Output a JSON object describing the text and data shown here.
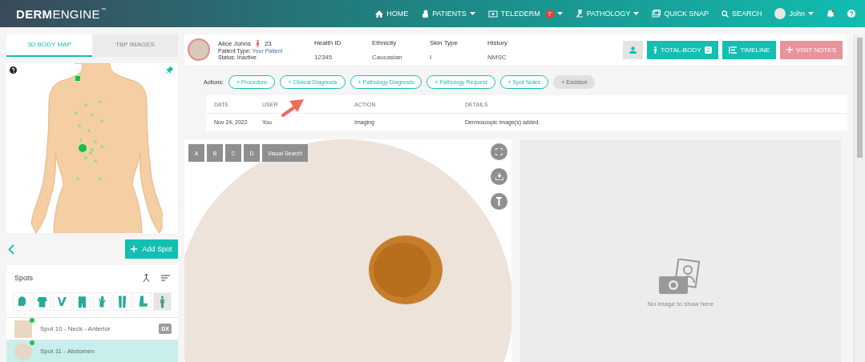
{
  "nav": {
    "logo_bold": "DERM",
    "logo_light": "ENGINE",
    "trademark": "™",
    "items": [
      {
        "label": "HOME",
        "dropdown": false
      },
      {
        "label": "PATIENTS",
        "dropdown": true
      },
      {
        "label": "TELEDERM",
        "badge": "7",
        "dropdown": true
      },
      {
        "label": "PATHOLOGY",
        "dropdown": true
      },
      {
        "label": "QUICK SNAP",
        "dropdown": false
      },
      {
        "label": "SEARCH",
        "dropdown": false
      }
    ],
    "user": {
      "name": "John",
      "dropdown": true
    }
  },
  "left": {
    "tabs": [
      {
        "label": "3D BODY MAP",
        "selected": true
      },
      {
        "label": "TBP IMAGES",
        "selected": false
      }
    ],
    "add_spot": "Add Spot",
    "spots_title": "Spots",
    "filters": [
      {
        "selected": false
      },
      {
        "selected": false
      },
      {
        "selected": false
      },
      {
        "selected": false
      },
      {
        "selected": false
      },
      {
        "selected": false
      },
      {
        "selected": false
      },
      {
        "selected": true
      }
    ],
    "spots": [
      {
        "name": "Spot 10 - Neck - Anterior",
        "badge": "DX",
        "selected": false
      },
      {
        "name": "Spot 11 - Abdomen",
        "selected": true
      }
    ]
  },
  "patient": {
    "name": "Alice Johns",
    "age": "23",
    "type_label": "Patient Type:",
    "type": "Your Patient",
    "status_label": "Status:",
    "status": "Inactive",
    "fields": [
      {
        "label": "Health ID",
        "value": "12345"
      },
      {
        "label": "Ethnicity",
        "value": "Caucasian"
      },
      {
        "label": "Skin Type",
        "value": "I"
      },
      {
        "label": "History",
        "value": "NMSC"
      }
    ],
    "total_body": {
      "label": "TOTAL-BODY",
      "count": "2"
    },
    "timeline": "TIMELINE",
    "visit_notes": "VISIT NOTES"
  },
  "actions": {
    "label": "Actions:",
    "items": [
      {
        "label": "+ Procedure",
        "disabled": false
      },
      {
        "label": "+ Clinical Diagnosis",
        "disabled": false
      },
      {
        "label": "+ Pathology Diagnosis",
        "disabled": false
      },
      {
        "label": "+ Pathology Request",
        "disabled": false
      },
      {
        "label": "+ Spot Notes",
        "disabled": false
      },
      {
        "label": "+ Excision",
        "disabled": true
      }
    ]
  },
  "table": {
    "columns": [
      "DATE",
      "USER",
      "ACTION",
      "DETAILS"
    ],
    "rows": [
      [
        "Nov 24, 2022",
        "You",
        "Imaging",
        "Dermoscopic image(s) added."
      ]
    ]
  },
  "viewer": {
    "tabs": [
      "A",
      "B",
      "C",
      "D",
      "Visual Search"
    ],
    "empty_text": "No image to show here"
  }
}
